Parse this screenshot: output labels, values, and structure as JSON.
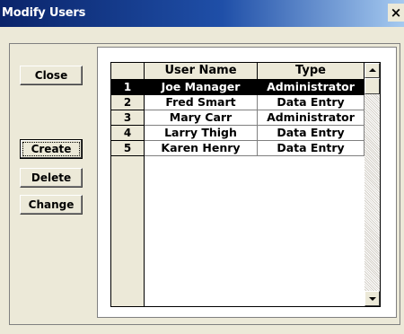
{
  "window": {
    "title": "Modify Users",
    "close_label": "×"
  },
  "buttons": {
    "close": "Close",
    "create": "Create",
    "delete": "Delete",
    "change": "Change"
  },
  "grid": {
    "columns": [
      "User Name",
      "Type"
    ],
    "rows": [
      {
        "num": "1",
        "user": "Joe Manager",
        "type": "Administrator",
        "selected": true
      },
      {
        "num": "2",
        "user": "Fred Smart",
        "type": "Data Entry",
        "selected": false
      },
      {
        "num": "3",
        "user": "Mary Carr",
        "type": "Administrator",
        "selected": false
      },
      {
        "num": "4",
        "user": "Larry Thigh",
        "type": "Data Entry",
        "selected": false
      },
      {
        "num": "5",
        "user": "Karen Henry",
        "type": "Data Entry",
        "selected": false
      }
    ]
  },
  "scrollbar": {
    "up_icon": "arrow-up-icon",
    "down_icon": "arrow-down-icon"
  },
  "colors": {
    "titlebar": "#0a246a",
    "selection": "#000000",
    "face": "#ece9d8"
  }
}
